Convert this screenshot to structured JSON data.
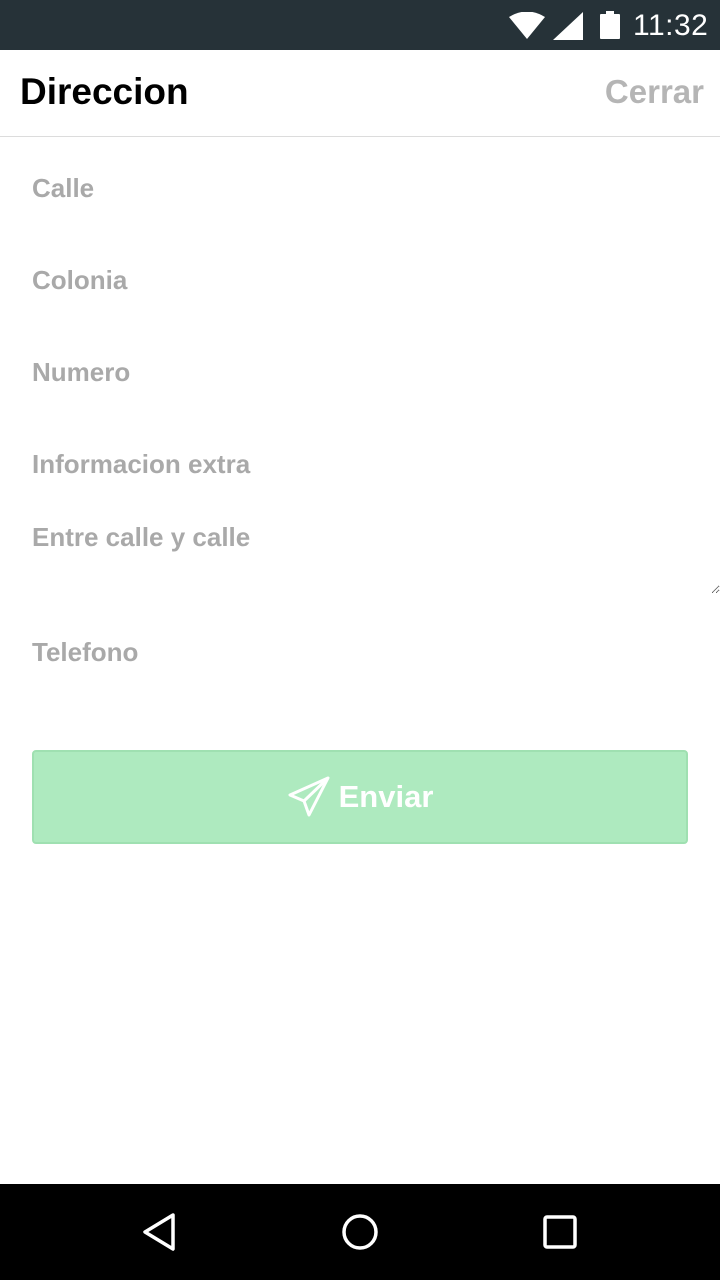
{
  "status_bar": {
    "time": "11:32",
    "icons": [
      "wifi-icon",
      "cell-signal-icon",
      "battery-icon"
    ]
  },
  "header": {
    "title": "Direccion",
    "close_label": "Cerrar"
  },
  "form": {
    "calle_placeholder": "Calle",
    "colonia_placeholder": "Colonia",
    "numero_placeholder": "Numero",
    "info_extra_placeholder": "Informacion extra",
    "entre_calles_placeholder": "Entre calle y calle",
    "telefono_placeholder": "Telefono",
    "submit_label": "Enviar",
    "submit_icon": "paper-plane-icon"
  },
  "nav_bar": {
    "icons": [
      "back-icon",
      "home-icon",
      "recents-icon"
    ]
  },
  "colors": {
    "status_bar": "#263238",
    "placeholder": "#a9a9a9",
    "button_bg": "#aeeabf",
    "close_text": "#b5b5b5"
  }
}
